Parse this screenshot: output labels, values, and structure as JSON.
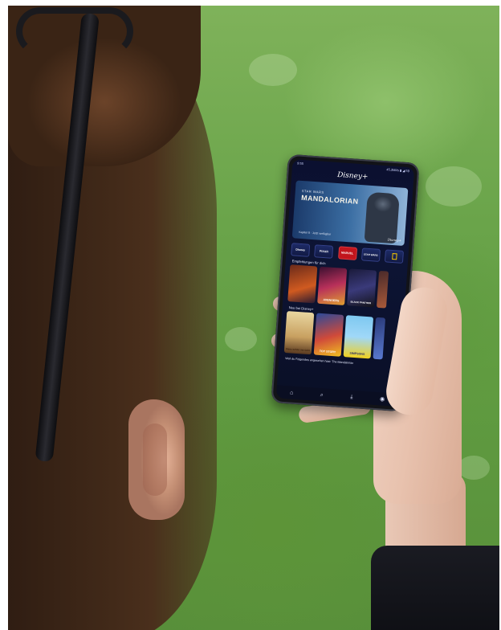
{
  "phone": {
    "status_left": "9:55",
    "status_right": "45,3kB/s ▮ ◢ 59",
    "brand_logo": "Disney+",
    "hero": {
      "overline": "STAR WARS",
      "title": "MANDALORIAN",
      "caption": "Kapitel 8 · Jetzt verfügbar",
      "badge": "Disney+"
    },
    "brands": [
      "Disney",
      "PIXAR",
      "MARVEL",
      "STAR WARS",
      "NATIONAL GEOGRAPHIC"
    ],
    "row1_title": "Empfehlungen für dich",
    "row1_tiles": [
      "",
      "AVENGERS",
      "BLACK PANTHER",
      ""
    ],
    "row2_title": "Neu bei Disney+",
    "row2_tiles": [
      "Ganz schön verrückt",
      "TOY STORY",
      "SIMPSONS",
      ""
    ],
    "row3_title": "Weil du Folgendes angesehen hast: The Mandalorian"
  },
  "icons": [
    "home-icon",
    "search-icon",
    "download-icon",
    "profile-icon"
  ],
  "colors": {
    "grass": "#6aa44a",
    "screen_bg": "#0b1030",
    "marvel_red": "#c2151d"
  }
}
